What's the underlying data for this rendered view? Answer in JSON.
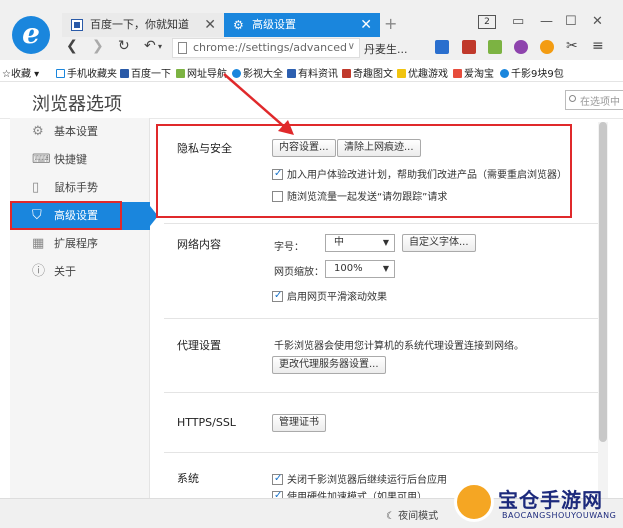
{
  "browser": {
    "tabs": [
      {
        "title": "百度一下，你就知道",
        "active": false
      },
      {
        "title": "高级设置",
        "active": true
      }
    ],
    "new_tab_label": "+",
    "window_badge": "2",
    "address": "chrome://settings/advanced",
    "search_engine_label": "丹麦生...",
    "bookmarks": [
      {
        "label": "收藏"
      },
      {
        "label": "手机收藏夹"
      },
      {
        "label": "百度一下"
      },
      {
        "label": "网址导航"
      },
      {
        "label": "影视大全"
      },
      {
        "label": "有料资讯"
      },
      {
        "label": "奇趣图文"
      },
      {
        "label": "优趣游戏"
      },
      {
        "label": "爱淘宝"
      },
      {
        "label": "千影9块9包"
      }
    ]
  },
  "settings": {
    "title": "浏览器选项",
    "search_placeholder": "在选项中",
    "nav": [
      {
        "label": "基本设置",
        "icon": "gear-icon",
        "active": false
      },
      {
        "label": "快捷键",
        "icon": "keyboard-icon",
        "active": false
      },
      {
        "label": "鼠标手势",
        "icon": "mouse-icon",
        "active": false
      },
      {
        "label": "高级设置",
        "icon": "shield-icon",
        "active": true
      },
      {
        "label": "扩展程序",
        "icon": "extensions-icon",
        "active": false
      },
      {
        "label": "关于",
        "icon": "info-icon",
        "active": false
      }
    ],
    "privacy": {
      "label": "隐私与安全",
      "content_settings_button": "内容设置...",
      "clear_history_button": "清除上网痕迹...",
      "improve_checkbox": "加入用户体验改进计划，帮助我们改进产品（需要重启浏览器）",
      "improve_checked": true,
      "dnt_checkbox": "随浏览流量一起发送“请勿跟踪”请求",
      "dnt_checked": false
    },
    "web_content": {
      "label": "网络内容",
      "font_size_label": "字号：",
      "font_size_value": "中",
      "custom_font_button": "自定义字体...",
      "zoom_label": "网页缩放：",
      "zoom_value": "100%",
      "smooth_scroll_checkbox": "启用网页平滑滚动效果",
      "smooth_scroll_checked": true
    },
    "proxy": {
      "label": "代理设置",
      "description": "千影浏览器会使用您计算机的系统代理设置连接到网络。",
      "change_button": "更改代理服务器设置..."
    },
    "https": {
      "label": "HTTPS/SSL",
      "manage_button": "管理证书"
    },
    "system": {
      "label": "系统",
      "background_checkbox": "关闭千影浏览器后继续运行后台应用",
      "background_checked": true,
      "hw_accel_checkbox": "使用硬件加速模式（如果可用）",
      "hw_accel_checked": true
    }
  },
  "statusbar": {
    "night_mode": "夜间模式"
  },
  "watermark": {
    "title": "宝仓手游网",
    "subtitle": "BAOCANGSHOUYOUWANG"
  },
  "colors": {
    "accent": "#1a86dd",
    "highlight": "#e0292b"
  }
}
